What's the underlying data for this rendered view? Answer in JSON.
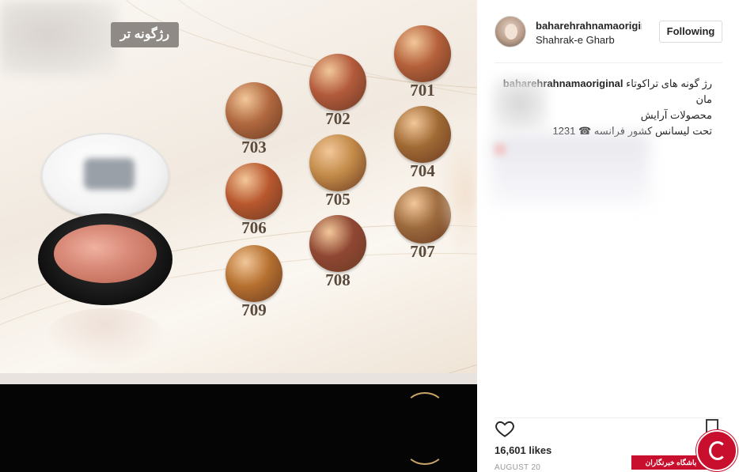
{
  "promo": {
    "title": "رژگونه تر",
    "swatches": [
      {
        "label": "701",
        "color": "#b4603a"
      },
      {
        "label": "702",
        "color": "#b25a3c"
      },
      {
        "label": "703",
        "color": "#b0683f"
      },
      {
        "label": "704",
        "color": "#a06a34"
      },
      {
        "label": "705",
        "color": "#c28a48"
      },
      {
        "label": "706",
        "color": "#b8572e"
      },
      {
        "label": "707",
        "color": "#9c6a3c"
      },
      {
        "label": "708",
        "color": "#8f4733"
      },
      {
        "label": "709",
        "color": "#b5702f"
      }
    ]
  },
  "post": {
    "username": "baharehrahnamaoriginal",
    "location": "Shahrak-e Gharb",
    "follow_label": "Following",
    "caption": {
      "user": "baharehrahnamaoriginal",
      "line1": "رژ گونه های تراکوتاء",
      "line2": "مان",
      "line3": "محصولات آرایش",
      "line4": "تحت لیسانس کشور فرانسه ☎ 1231"
    },
    "likes": "16,601 likes",
    "date": "AUGUST 20"
  },
  "watermark": {
    "label": "باشگاه خبرنگاران"
  }
}
